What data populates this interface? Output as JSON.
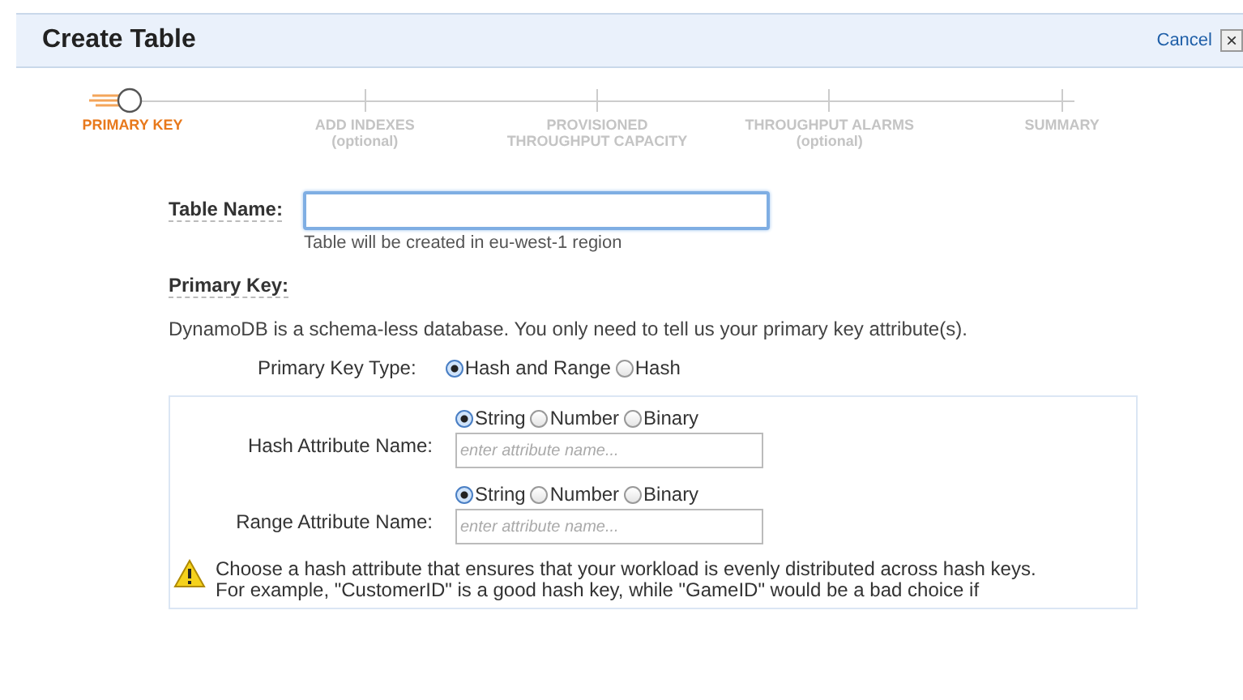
{
  "window": {
    "title": "Create Table",
    "cancel": "Cancel",
    "close": "×"
  },
  "steps": [
    {
      "label": "PRIMARY KEY",
      "selected": true
    },
    {
      "label": "ADD INDEXES",
      "sub": "(optional)",
      "selected": false
    },
    {
      "label": "PROVISIONED",
      "sub": "THROUGHPUT CAPACITY",
      "selected": false
    },
    {
      "label": "THROUGHPUT ALARMS",
      "sub": "(optional)",
      "selected": false
    },
    {
      "label": "SUMMARY",
      "selected": false
    }
  ],
  "table_name": {
    "label": "Table Name:",
    "hint": "Table will be created in eu-west-1 region"
  },
  "primary_key": {
    "heading": "Primary Key:",
    "description": "DynamoDB is a schema-less database. You only need to tell us your primary key attribute(s).",
    "type_label": "Primary Key Type:",
    "types": [
      {
        "label": "Hash and Range",
        "selected": true
      },
      {
        "label": "Hash",
        "selected": false
      }
    ]
  },
  "attributes": [
    {
      "label": "Hash Attribute Name:",
      "placeholder": "enter attribute name...",
      "types": [
        {
          "label": "String",
          "selected": true
        },
        {
          "label": "Number",
          "selected": false
        },
        {
          "label": "Binary",
          "selected": false
        }
      ]
    },
    {
      "label": "Range Attribute Name:",
      "placeholder": "enter attribute name...",
      "types": [
        {
          "label": "String",
          "selected": true
        },
        {
          "label": "Number",
          "selected": false
        },
        {
          "label": "Binary",
          "selected": false
        }
      ]
    }
  ],
  "warning": {
    "text": "Choose a hash attribute that ensures that your workload is evenly distributed across hash keys.",
    "example": "For example, \"CustomerID\" is a good hash key, while \"GameID\" would be a bad choice if"
  }
}
